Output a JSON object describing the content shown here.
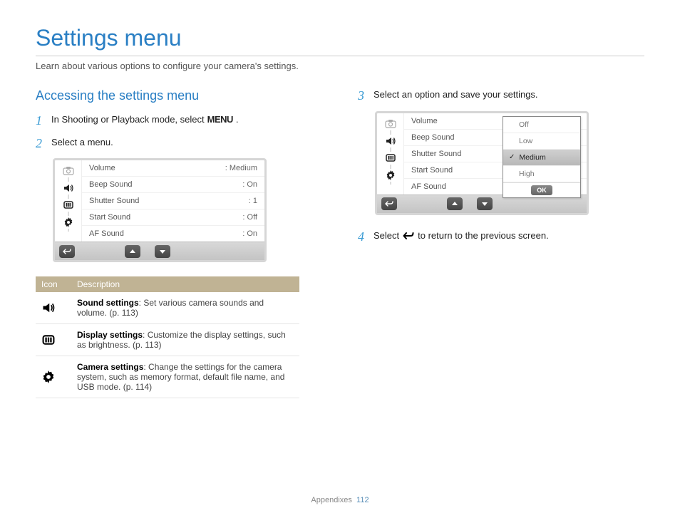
{
  "title": "Settings menu",
  "subtitle": "Learn about various options to configure your camera's settings.",
  "section_heading": "Accessing the settings menu",
  "steps": {
    "1": {
      "num": "1",
      "text_before": "In Shooting or Playback mode, select ",
      "inline_label": "MENU",
      "text_after": "."
    },
    "2": {
      "num": "2",
      "text": "Select a menu."
    },
    "3": {
      "num": "3",
      "text": "Select an option and save your settings."
    },
    "4": {
      "num": "4",
      "text_before": "Select ",
      "text_after": " to return to the previous screen."
    }
  },
  "menu1": {
    "rows": [
      {
        "k": "Volume",
        "v": ": Medium"
      },
      {
        "k": "Beep Sound",
        "v": ": On"
      },
      {
        "k": "Shutter Sound",
        "v": ": 1"
      },
      {
        "k": "Start Sound",
        "v": ": Off"
      },
      {
        "k": "AF Sound",
        "v": ": On"
      }
    ]
  },
  "menu2": {
    "rows": [
      {
        "k": "Volume"
      },
      {
        "k": "Beep Sound"
      },
      {
        "k": "Shutter Sound"
      },
      {
        "k": "Start Sound"
      },
      {
        "k": "AF Sound"
      }
    ],
    "options": [
      {
        "label": "Off",
        "selected": false
      },
      {
        "label": "Low",
        "selected": false
      },
      {
        "label": "Medium",
        "selected": true
      },
      {
        "label": "High",
        "selected": false
      }
    ],
    "ok_label": "OK"
  },
  "icon_table": {
    "headers": {
      "icon": "Icon",
      "desc": "Description"
    },
    "rows": [
      {
        "title": "Sound settings",
        "body": ": Set various camera sounds and volume. (p. 113)"
      },
      {
        "title": "Display settings",
        "body": ": Customize the display settings, such as brightness. (p. 113)"
      },
      {
        "title": "Camera settings",
        "body": ": Change the settings for the camera system, such as memory format, default file name, and USB mode. (p. 114)"
      }
    ]
  },
  "footer": {
    "label": "Appendixes",
    "page": "112"
  }
}
